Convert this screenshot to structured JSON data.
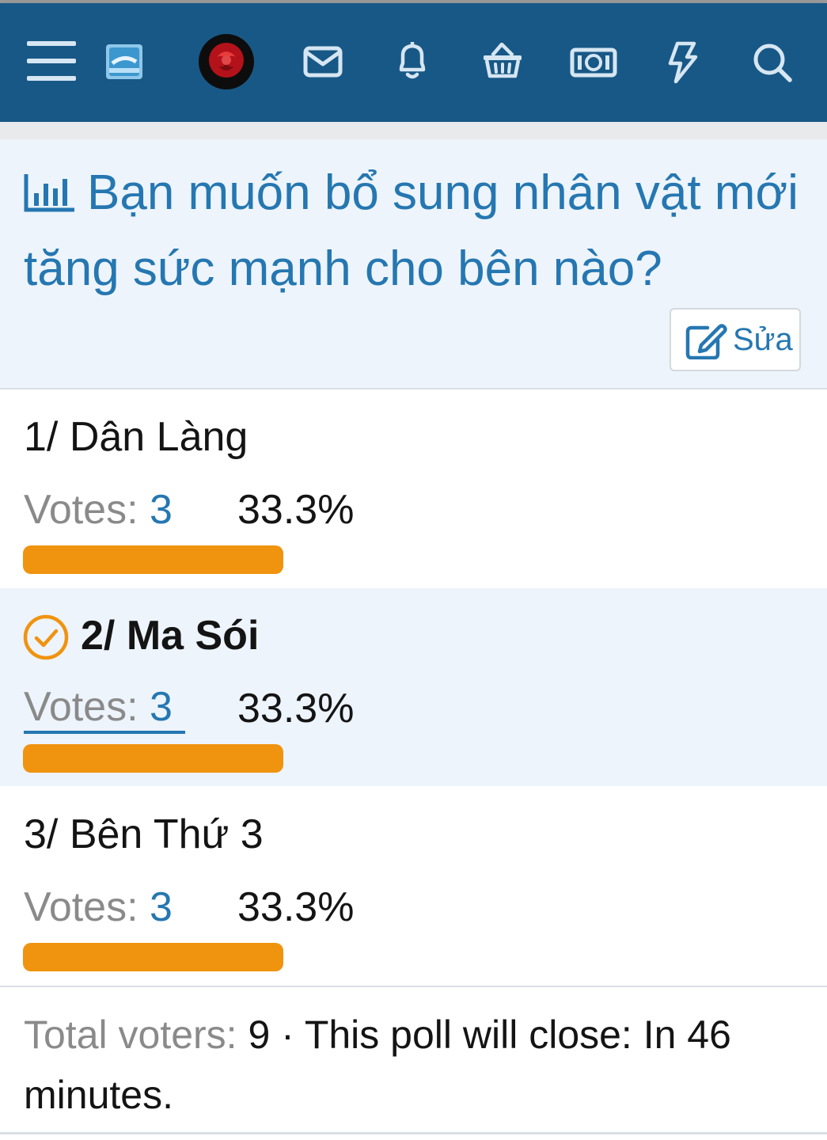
{
  "poll": {
    "title": "Bạn muốn bổ sung nhân vật mới tăng sức mạnh cho bên nào?",
    "edit_label": "Sửa",
    "options": [
      {
        "label": "1/ Dân Làng",
        "votes_label": "Votes:",
        "votes": "3",
        "percent": "33.3%",
        "share": 0.333,
        "selected": false
      },
      {
        "label": "2/ Ma Sói",
        "votes_label": "Votes:",
        "votes": "3",
        "percent": "33.3%",
        "share": 0.333,
        "selected": true
      },
      {
        "label": "3/ Bên Thứ 3",
        "votes_label": "Votes:",
        "votes": "3",
        "percent": "33.3%",
        "share": 0.333,
        "selected": false
      }
    ],
    "footer": {
      "total_label": "Total voters:",
      "total_value": "9",
      "separator": " · ",
      "close_text": "This poll will close: In 46 minutes."
    }
  },
  "colors": {
    "navbar": "#185886",
    "accent": "#2577b1",
    "bar": "#f0930f",
    "highlight_bg": "#edf4fb"
  },
  "icons": [
    "menu-icon",
    "site-logo",
    "avatar",
    "envelope-icon",
    "bell-icon",
    "basket-icon",
    "money-icon",
    "bolt-icon",
    "search-icon",
    "chart-icon",
    "edit-icon",
    "check-circle-icon"
  ]
}
